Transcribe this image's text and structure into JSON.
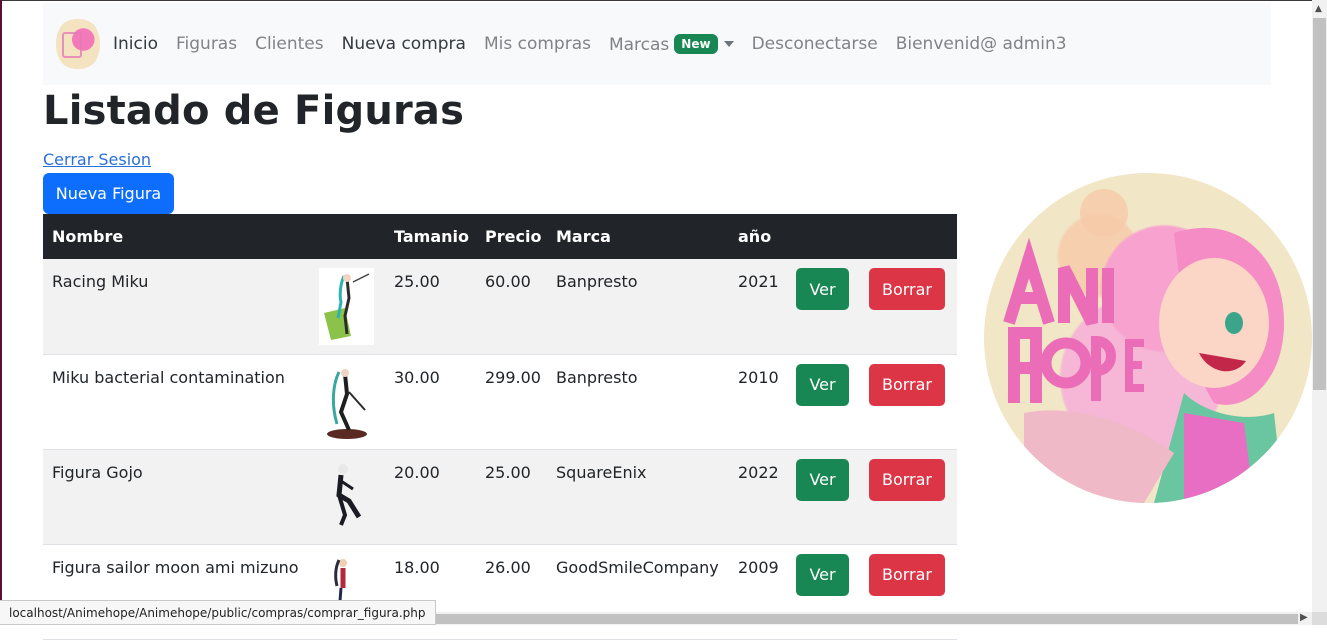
{
  "navbar": {
    "items": [
      {
        "label": "Inicio",
        "active": true
      },
      {
        "label": "Figuras",
        "active": false
      },
      {
        "label": "Clientes",
        "active": false
      },
      {
        "label": "Nueva compra",
        "active": true
      },
      {
        "label": "Mis compras",
        "active": false
      },
      {
        "label": "Marcas",
        "active": false,
        "badge": "New",
        "dropdown": true
      },
      {
        "label": "Desconectarse",
        "active": false
      },
      {
        "label": "Bienvenid@ admin3",
        "active": false
      }
    ]
  },
  "page": {
    "title": "Listado de Figuras",
    "logout_link": "Cerrar Sesion",
    "new_button": "Nueva Figura"
  },
  "table": {
    "headers": [
      "Nombre",
      "",
      "Tamanio",
      "Precio",
      "Marca",
      "año",
      "",
      ""
    ],
    "rows": [
      {
        "nombre": "Racing Miku",
        "tamanio": "25.00",
        "precio": "60.00",
        "marca": "Banpresto",
        "anio": "2021",
        "ver": "Ver",
        "borrar": "Borrar"
      },
      {
        "nombre": "Miku bacterial contamination",
        "tamanio": "30.00",
        "precio": "299.00",
        "marca": "Banpresto",
        "anio": "2010",
        "ver": "Ver",
        "borrar": "Borrar"
      },
      {
        "nombre": "Figura Gojo",
        "tamanio": "20.00",
        "precio": "25.00",
        "marca": "SquareEnix",
        "anio": "2022",
        "ver": "Ver",
        "borrar": "Borrar"
      },
      {
        "nombre": "Figura sailor moon ami mizuno",
        "tamanio": "18.00",
        "precio": "26.00",
        "marca": "GoodSmileCompany",
        "anio": "2009",
        "ver": "Ver",
        "borrar": "Borrar"
      }
    ]
  },
  "status_bar": {
    "url": "localhost/Animehope/Animehope/public/compras/comprar_figura.php"
  },
  "colors": {
    "primary": "#0d6efd",
    "success": "#198754",
    "danger": "#dc3545",
    "dark": "#212529"
  }
}
